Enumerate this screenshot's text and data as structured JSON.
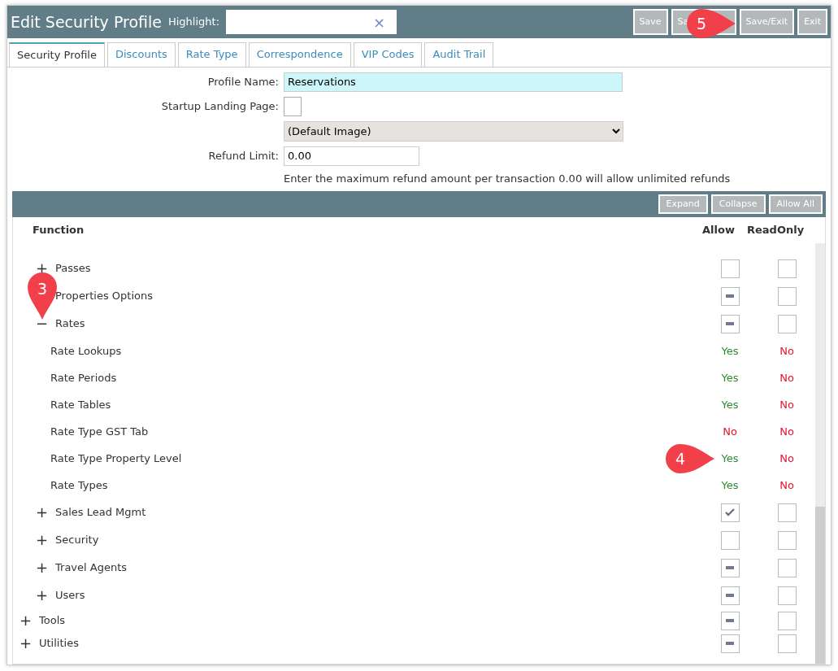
{
  "window": {
    "title": "Edit Security Profile"
  },
  "highlight": {
    "label": "Highlight:",
    "clear": "×"
  },
  "header_buttons": [
    "Save",
    "Sa",
    "Save/Exit",
    "Exit"
  ],
  "tabs": [
    {
      "label": "Security Profile",
      "selected": true
    },
    {
      "label": "Discounts",
      "selected": false
    },
    {
      "label": "Rate Type",
      "selected": false
    },
    {
      "label": "Correspondence",
      "selected": false
    },
    {
      "label": "VIP Codes",
      "selected": false
    },
    {
      "label": "Audit Trail",
      "selected": false
    }
  ],
  "form": {
    "profile_name_label": "Profile Name:",
    "profile_name": "Reservations",
    "landing_label": "Startup Landing Page:",
    "landing_checked": false,
    "image_select": "(Default Image)",
    "refund_label": "Refund Limit:",
    "refund_value": "0.00",
    "refund_hint": "Enter the maximum refund amount per transaction 0.00 will allow unlimited refunds"
  },
  "toolbar_buttons": [
    "Expand",
    "Collapse",
    "Allow All"
  ],
  "columns": [
    "Function",
    "Allow",
    "ReadOnly"
  ],
  "tree": [
    {
      "children": [
        {
          "toggle": "+",
          "label": "Passes",
          "allow_checked": false,
          "allow_partial": false,
          "readonly_checked": false
        },
        {
          "label": "Properties Options",
          "allow_checked": false,
          "allow_partial": true,
          "readonly_checked": false
        },
        {
          "toggle": "−",
          "label": "Rates",
          "allow_checked": false,
          "allow_partial": true,
          "readonly_checked": false,
          "children": [
            {
              "label": "Rate Lookups",
              "allow": "Yes",
              "allow_granted": true,
              "readonly": "No",
              "readonly_granted": false
            },
            {
              "label": "Rate Periods",
              "allow": "Yes",
              "allow_granted": true,
              "readonly": "No",
              "readonly_granted": false
            },
            {
              "label": "Rate Tables",
              "allow": "Yes",
              "allow_granted": true,
              "readonly": "No",
              "readonly_granted": false
            },
            {
              "label": "Rate Type GST Tab",
              "allow": "No",
              "allow_granted": false,
              "readonly": "No",
              "readonly_granted": false
            },
            {
              "label": "Rate Type Property Level",
              "allow": "Yes",
              "allow_granted": true,
              "readonly": "No",
              "readonly_granted": false
            },
            {
              "label": "Rate Types",
              "allow": "Yes",
              "allow_granted": true,
              "readonly": "No",
              "readonly_granted": false
            }
          ]
        },
        {
          "toggle": "+",
          "label": "Sales Lead Mgmt",
          "allow_checked": true,
          "readonly_checked": false
        },
        {
          "toggle": "+",
          "label": "Security",
          "allow_checked": false,
          "allow_partial": false,
          "readonly_checked": false
        },
        {
          "toggle": "+",
          "label": "Travel Agents",
          "allow_checked": false,
          "allow_partial": true,
          "readonly_checked": false
        },
        {
          "toggle": "+",
          "label": "Users",
          "allow_checked": false,
          "allow_partial": true,
          "readonly_checked": false
        }
      ]
    },
    {
      "toggle": "+",
      "label": "Tools",
      "allow_checked": false,
      "allow_partial": true,
      "readonly_checked": false
    },
    {
      "toggle": "+",
      "label": "Utilities",
      "allow_checked": false,
      "allow_partial": true,
      "readonly_checked": false
    }
  ],
  "callouts": [
    {
      "number": "5",
      "kind": "right"
    },
    {
      "number": "3",
      "kind": "down"
    },
    {
      "number": "4",
      "kind": "right"
    }
  ]
}
